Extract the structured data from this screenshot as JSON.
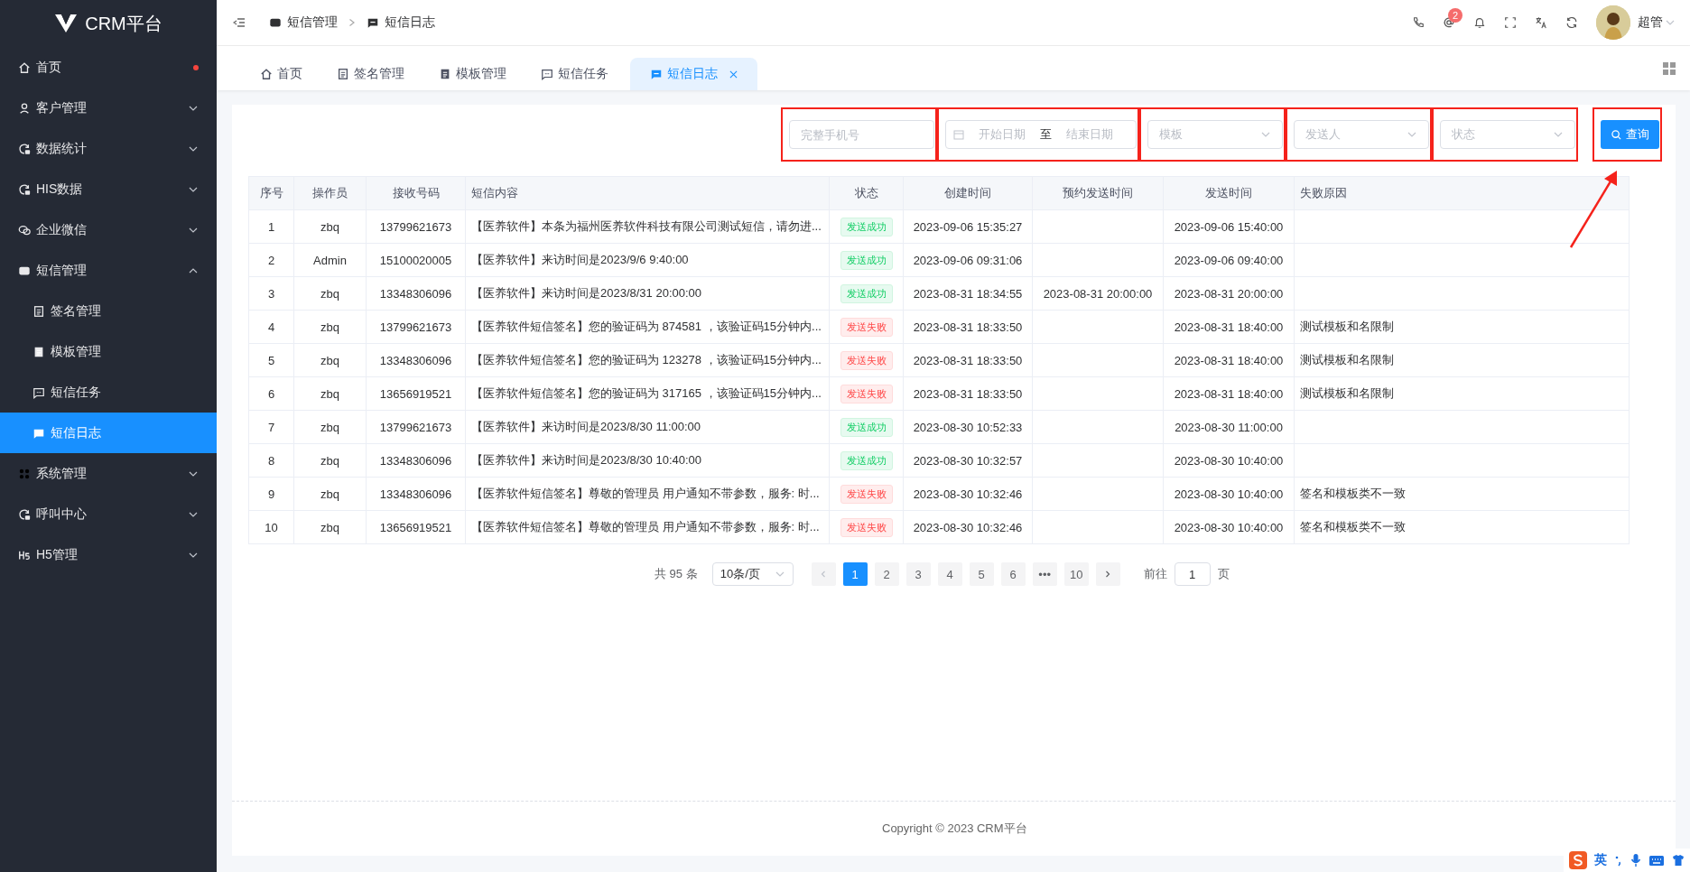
{
  "sidebar": {
    "logo": "CRM平台",
    "items": [
      {
        "label": "首页",
        "dot": true
      },
      {
        "label": "客户管理",
        "expanded": false
      },
      {
        "label": "数据统计",
        "expanded": false
      },
      {
        "label": "HIS数据",
        "expanded": false
      },
      {
        "label": "企业微信",
        "expanded": false
      },
      {
        "label": "短信管理",
        "expanded": true,
        "children": [
          {
            "label": "签名管理",
            "selected": false
          },
          {
            "label": "模板管理",
            "selected": false
          },
          {
            "label": "短信任务",
            "selected": false
          },
          {
            "label": "短信日志",
            "selected": true
          }
        ]
      },
      {
        "label": "系统管理",
        "expanded": false
      },
      {
        "label": "呼叫中心",
        "expanded": false
      },
      {
        "label": "H5管理",
        "expanded": false
      }
    ]
  },
  "breadcrumb": [
    "短信管理",
    "短信日志"
  ],
  "header": {
    "notification_count": "2",
    "user": "超管"
  },
  "tabs": [
    {
      "label": "首页",
      "selected": false
    },
    {
      "label": "签名管理",
      "selected": false
    },
    {
      "label": "模板管理",
      "selected": false
    },
    {
      "label": "短信任务",
      "selected": false
    },
    {
      "label": "短信日志",
      "selected": true
    }
  ],
  "filters": {
    "phone": {
      "placeholder": "完整手机号"
    },
    "date_start": {
      "placeholder": "开始日期"
    },
    "date_separator": "至",
    "date_end": {
      "placeholder": "结束日期"
    },
    "template": {
      "placeholder": "模板"
    },
    "sender": {
      "placeholder": "发送人"
    },
    "status": {
      "placeholder": "状态"
    },
    "search_button": "查询"
  },
  "table": {
    "columns": [
      "序号",
      "操作员",
      "接收号码",
      "短信内容",
      "状态",
      "创建时间",
      "预约发送时间",
      "发送时间",
      "失败原因"
    ],
    "rows": [
      {
        "no": "1",
        "operator": "zbq",
        "phone": "13799621673",
        "content": "【医养软件】本条为福州医养软件科技有限公司测试短信，请勿进...",
        "status": "发送成功",
        "kind": "success",
        "created": "2023-09-06 15:35:27",
        "scheduled": "",
        "sent": "2023-09-06 15:40:00",
        "reason": ""
      },
      {
        "no": "2",
        "operator": "Admin",
        "phone": "15100020005",
        "content": "【医养软件】来访时间是2023/9/6 9:40:00",
        "status": "发送成功",
        "kind": "success",
        "created": "2023-09-06 09:31:06",
        "scheduled": "",
        "sent": "2023-09-06 09:40:00",
        "reason": ""
      },
      {
        "no": "3",
        "operator": "zbq",
        "phone": "13348306096",
        "content": "【医养软件】来访时间是2023/8/31 20:00:00",
        "status": "发送成功",
        "kind": "success",
        "created": "2023-08-31 18:34:55",
        "scheduled": "2023-08-31 20:00:00",
        "sent": "2023-08-31 20:00:00",
        "reason": ""
      },
      {
        "no": "4",
        "operator": "zbq",
        "phone": "13799621673",
        "content": "【医养软件短信签名】您的验证码为 874581 ，该验证码15分钟内...",
        "status": "发送失败",
        "kind": "fail",
        "created": "2023-08-31 18:33:50",
        "scheduled": "",
        "sent": "2023-08-31 18:40:00",
        "reason": "测试模板和名限制"
      },
      {
        "no": "5",
        "operator": "zbq",
        "phone": "13348306096",
        "content": "【医养软件短信签名】您的验证码为 123278 ，该验证码15分钟内...",
        "status": "发送失败",
        "kind": "fail",
        "created": "2023-08-31 18:33:50",
        "scheduled": "",
        "sent": "2023-08-31 18:40:00",
        "reason": "测试模板和名限制"
      },
      {
        "no": "6",
        "operator": "zbq",
        "phone": "13656919521",
        "content": "【医养软件短信签名】您的验证码为 317165 ，该验证码15分钟内...",
        "status": "发送失败",
        "kind": "fail",
        "created": "2023-08-31 18:33:50",
        "scheduled": "",
        "sent": "2023-08-31 18:40:00",
        "reason": "测试模板和名限制"
      },
      {
        "no": "7",
        "operator": "zbq",
        "phone": "13799621673",
        "content": "【医养软件】来访时间是2023/8/30 11:00:00",
        "status": "发送成功",
        "kind": "success",
        "created": "2023-08-30 10:52:33",
        "scheduled": "",
        "sent": "2023-08-30 11:00:00",
        "reason": ""
      },
      {
        "no": "8",
        "operator": "zbq",
        "phone": "13348306096",
        "content": "【医养软件】来访时间是2023/8/30 10:40:00",
        "status": "发送成功",
        "kind": "success",
        "created": "2023-08-30 10:32:57",
        "scheduled": "",
        "sent": "2023-08-30 10:40:00",
        "reason": ""
      },
      {
        "no": "9",
        "operator": "zbq",
        "phone": "13348306096",
        "content": "【医养软件短信签名】尊敬的管理员 用户通知不带参数，服务: 时...",
        "status": "发送失败",
        "kind": "fail",
        "created": "2023-08-30 10:32:46",
        "scheduled": "",
        "sent": "2023-08-30 10:40:00",
        "reason": "签名和模板类不一致"
      },
      {
        "no": "10",
        "operator": "zbq",
        "phone": "13656919521",
        "content": "【医养软件短信签名】尊敬的管理员 用户通知不带参数，服务: 时...",
        "status": "发送失败",
        "kind": "fail",
        "created": "2023-08-30 10:32:46",
        "scheduled": "",
        "sent": "2023-08-30 10:40:00",
        "reason": "签名和模板类不一致"
      }
    ]
  },
  "pagination": {
    "total": "共 95 条",
    "page_size": "10条/页",
    "pages": [
      {
        "label": "1",
        "selected": true
      },
      {
        "label": "2",
        "selected": false
      },
      {
        "label": "3",
        "selected": false
      },
      {
        "label": "4",
        "selected": false
      },
      {
        "label": "5",
        "selected": false
      },
      {
        "label": "6",
        "selected": false
      },
      {
        "label": "•••",
        "selected": false
      },
      {
        "label": "10",
        "selected": false
      }
    ],
    "goto_label": "前往",
    "goto_value": "1",
    "goto_unit": "页"
  },
  "footer": "Copyright ©  2023 CRM平台",
  "ime": {
    "label": "英"
  }
}
